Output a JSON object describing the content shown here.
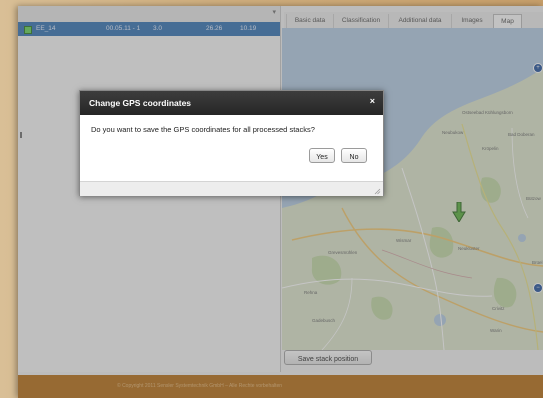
{
  "stack_list": {
    "row": {
      "name": "EE_14",
      "date": "00.05.11 - 1",
      "value1": "3.0",
      "value2": "26.26",
      "value3": "10.19"
    }
  },
  "tabs": [
    {
      "label": "Basic data"
    },
    {
      "label": "Classification"
    },
    {
      "label": "Additional data"
    },
    {
      "label": "Images"
    },
    {
      "label": "Map",
      "active": true
    }
  ],
  "map": {
    "labels": [
      "Ostseebad Kühlungsborn",
      "Neubukow",
      "Kröpelin",
      "Bad Doberan",
      "Wismar",
      "Neukloster",
      "Grevesmühlen",
      "Warin",
      "Rehna",
      "Brüel",
      "Crivitz",
      "Gadebusch",
      "Bützow"
    ],
    "marker_color": "#5fb142"
  },
  "save_stack_position_label": "Save stack position",
  "dialog": {
    "title": "Change GPS coordinates",
    "message": "Do you want to save the GPS coordinates for all processed stacks?",
    "yes_label": "Yes",
    "no_label": "No"
  },
  "footer": {
    "text": "© Copyright 2011 Sensler Systemtechnik GmbH – Alle Rechte vorbehalten"
  },
  "colors": {
    "selected_row": "#3d78b5",
    "dialog_titlebar": "#2b2b2b",
    "footer": "#b8741f"
  }
}
